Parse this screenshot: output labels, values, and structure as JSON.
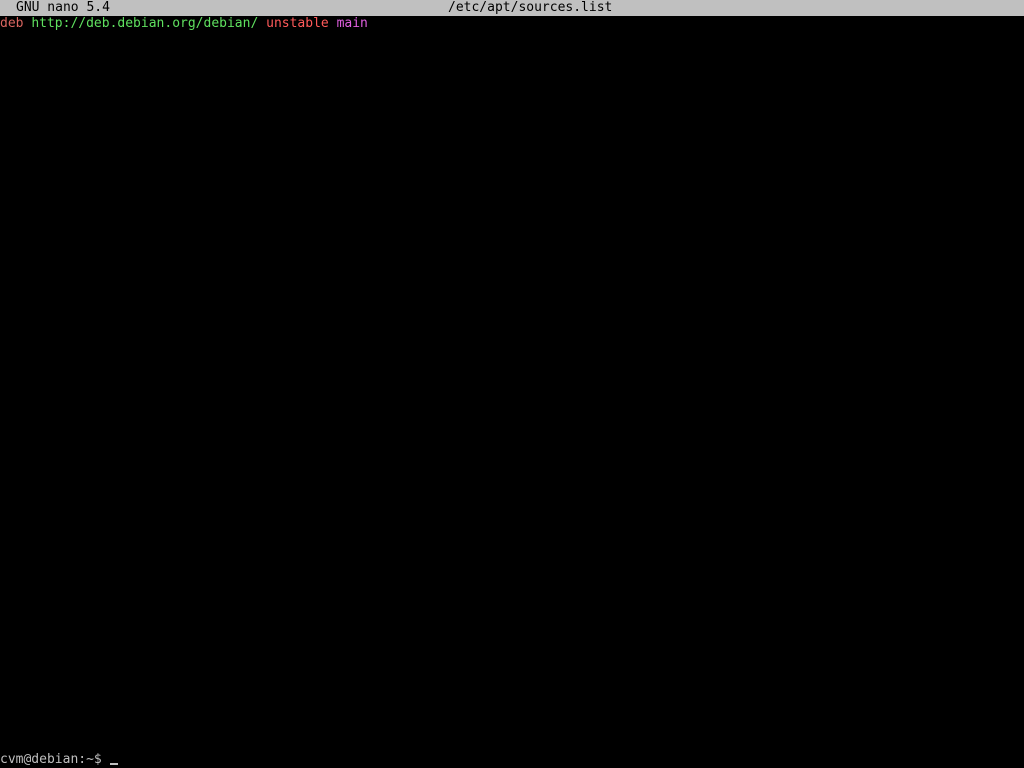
{
  "titlebar": {
    "app": "GNU nano 5.4",
    "file": "/etc/apt/sources.list"
  },
  "editor": {
    "line1": {
      "type": "deb",
      "url": "http://deb.debian.org/debian/",
      "distribution": "unstable",
      "component": "main"
    }
  },
  "prompt": {
    "text": "cvm@debian:~$"
  },
  "colors": {
    "background": "#000000",
    "titlebar_bg": "#c0c0c0",
    "type": "#d8655f",
    "url": "#5fe05f",
    "distribution": "#ff5a5a",
    "component": "#e05fe0",
    "text": "#bfbfbf"
  }
}
